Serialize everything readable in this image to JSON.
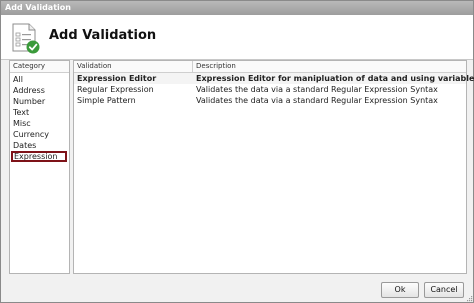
{
  "window": {
    "title": "Add Validation"
  },
  "header": {
    "title": "Add Validation",
    "icon": "validation-form-icon"
  },
  "category": {
    "heading": "Category",
    "items": [
      "All",
      "Address",
      "Number",
      "Text",
      "Misc",
      "Currency",
      "Dates",
      "Expression"
    ],
    "selected": "Expression"
  },
  "grid": {
    "columns": [
      "Validation",
      "Description"
    ],
    "rows": [
      {
        "name": "Expression Editor",
        "description": "Expression Editor for manipluation of data and using variables"
      },
      {
        "name": "Regular Expression",
        "description": "Validates the data via a standard Regular Expression Syntax"
      },
      {
        "name": "Simple Pattern",
        "description": "Validates the data via a standard Regular Expression Syntax"
      }
    ],
    "selected_row": 0
  },
  "buttons": {
    "ok": "Ok",
    "cancel": "Cancel"
  },
  "colors": {
    "selection_border": "#7e1218",
    "check_green": "#3a9a3a"
  }
}
